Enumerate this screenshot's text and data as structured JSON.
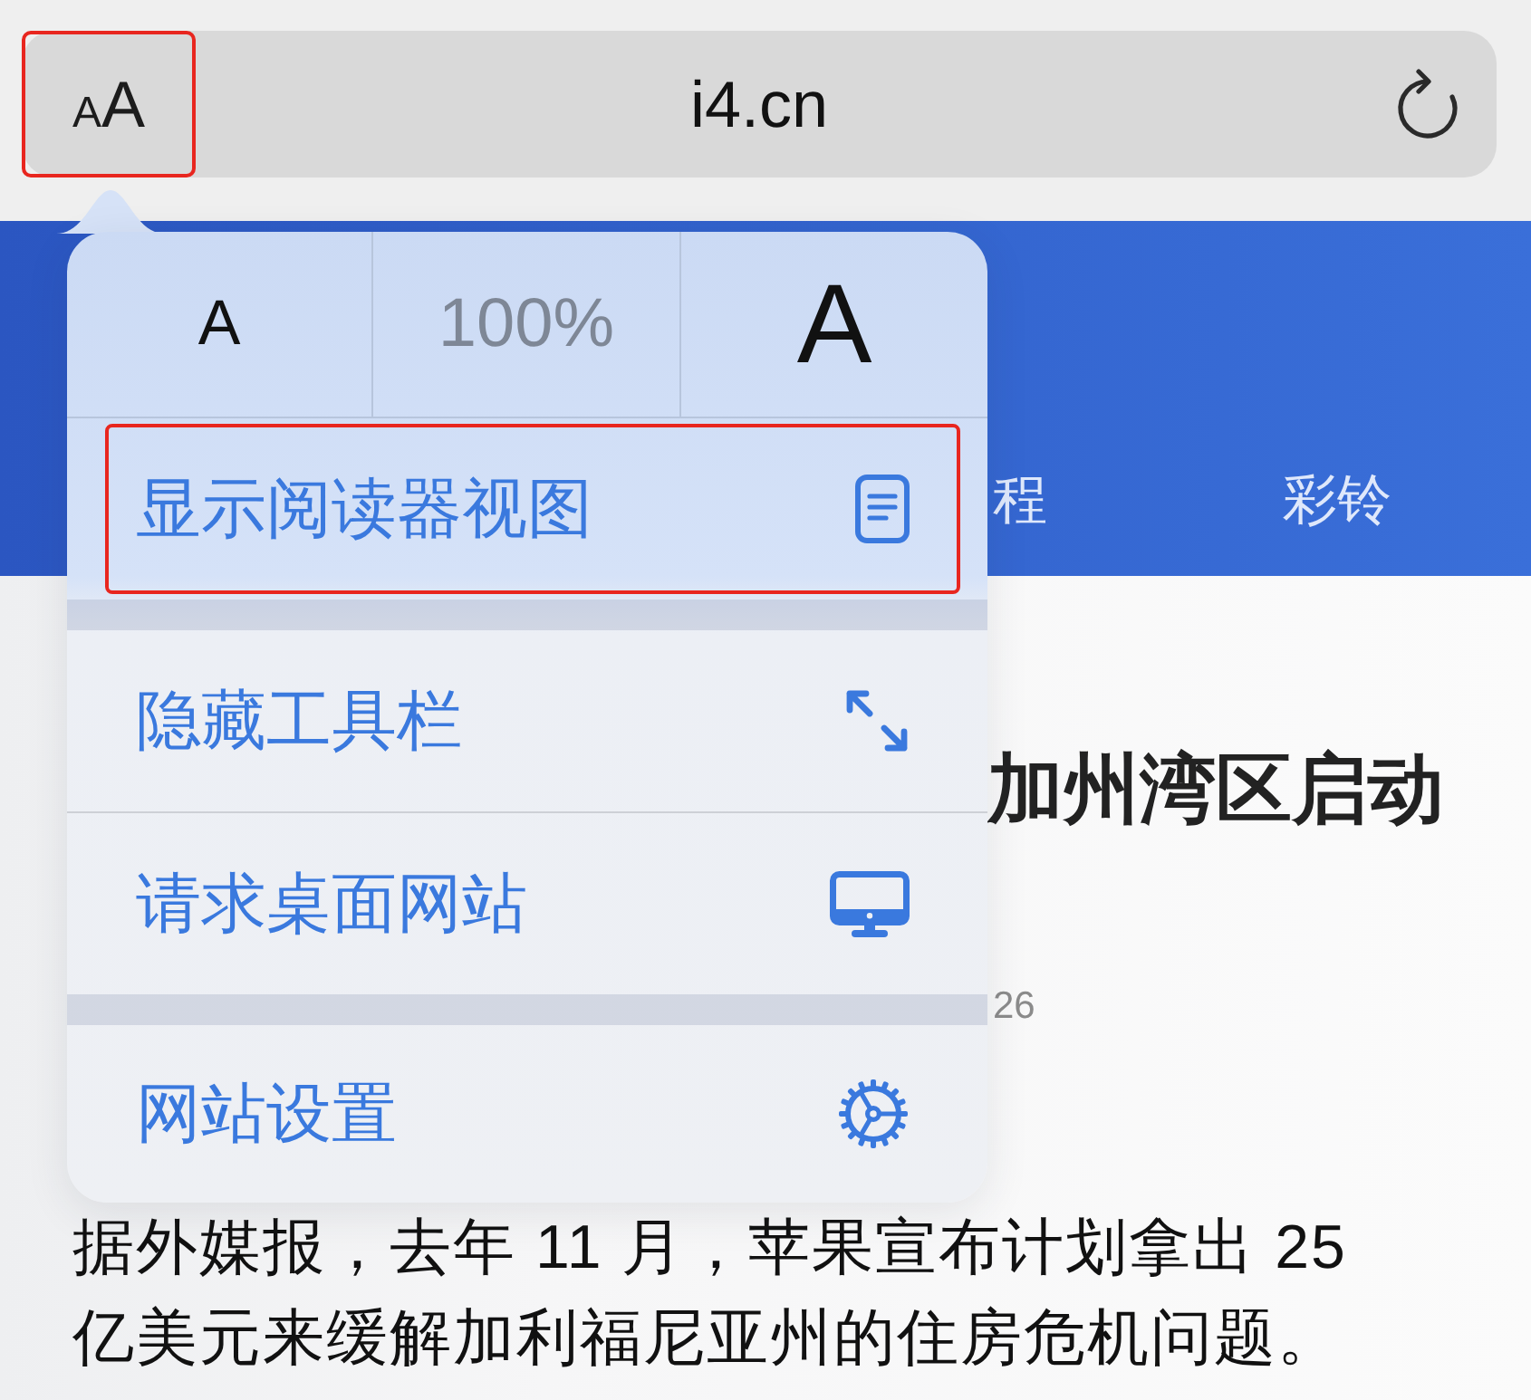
{
  "toolbar": {
    "text_size_button": {
      "small": "A",
      "large": "A",
      "highlighted": true
    },
    "address": "i4.cn"
  },
  "nav": [
    {
      "label": "程"
    },
    {
      "label": "彩铃"
    }
  ],
  "article": {
    "title": "加州湾区启动",
    "date": "26",
    "body": "据外媒报，去年 11 月，苹果宣布计划拿出 25 亿美元来缓解加利福尼亚州的住房危机问题。"
  },
  "popover": {
    "text_size": {
      "decrease": "A",
      "zoom": "100%",
      "increase": "A"
    },
    "groups": [
      {
        "items": [
          {
            "label": "显示阅读器视图",
            "highlighted": true
          }
        ]
      },
      {
        "items": [
          {
            "label": "隐藏工具栏",
            "highlighted": false
          },
          {
            "label": "请求桌面网站",
            "highlighted": false
          }
        ]
      },
      {
        "items": [
          {
            "label": "网站设置",
            "highlighted": false
          }
        ]
      }
    ]
  }
}
